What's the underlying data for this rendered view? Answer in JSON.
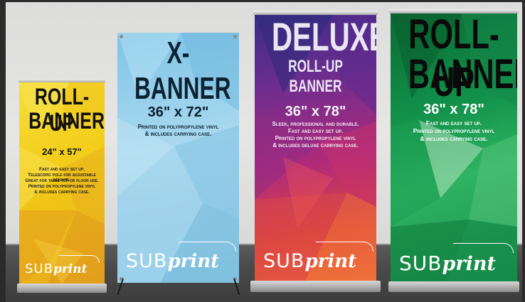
{
  "banners": [
    {
      "headline": [
        "ROLL-UP",
        "BANNER"
      ],
      "size": "24\" x 57\"",
      "details": [
        "Fast and easy set up.",
        "Telescopic pole for adjustable heights.",
        "Great for table top or floor use.",
        "Printed on polypropylene vinyl",
        "& includes carrying case."
      ],
      "logo": {
        "sub": "SUB",
        "print": "print"
      },
      "colors": [
        "#f4d215",
        "#e8a51a",
        "#f7e04a"
      ]
    },
    {
      "headline": [
        "X-BANNER"
      ],
      "size": "36\" x 72\"",
      "details": [
        "Printed on polypropylene vinyl",
        "& includes carrying case."
      ],
      "logo": {
        "sub": "SUB",
        "print": "print"
      },
      "colors": [
        "#8ecde8",
        "#b8e0f0",
        "#6fb7dc"
      ]
    },
    {
      "headline": [
        "DELUXE",
        "ROLL-UP BANNER"
      ],
      "size": "36\" x 78\"",
      "details": [
        "Sleek, professional and durable.",
        "Fast and easy set up.",
        "Printed on polypropylene vinyl",
        "& includes deluxe carrying case."
      ],
      "logo": {
        "sub": "SUB",
        "print": "print"
      },
      "colors": [
        "#4a2a8c",
        "#b5287a",
        "#e24a3a"
      ]
    },
    {
      "headline": [
        "ROLL-UP",
        "BANNER"
      ],
      "size": "36\" x 78\"",
      "details": [
        "Fast and easy set up.",
        "Printed on polypropylene vinyl",
        "& includes carrying case."
      ],
      "logo": {
        "sub": "SUB",
        "print": "print"
      },
      "colors": [
        "#0f7a3c",
        "#1fa356",
        "#7cd08f"
      ]
    }
  ]
}
